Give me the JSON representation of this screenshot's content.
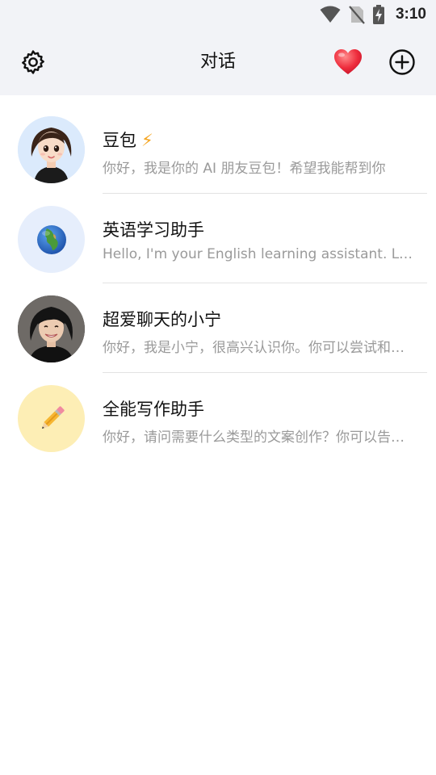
{
  "status_bar": {
    "time": "3:10",
    "icons": [
      "wifi-icon",
      "no-sim-icon",
      "battery-charging-icon"
    ]
  },
  "header": {
    "title": "对话",
    "left_icon": "gear-icon",
    "right_icons": [
      "heart-icon",
      "add-circle-icon"
    ]
  },
  "conversations": [
    {
      "name": "豆包",
      "badge": "⚡",
      "preview": "你好，我是你的 AI 朋友豆包！希望我能帮到你",
      "avatar_bg": "#dbeafc",
      "avatar_icon": "cartoon-girl-avatar"
    },
    {
      "name": "英语学习助手",
      "preview": "Hello, I'm your English learning assistant. Let's start!",
      "avatar_bg": "#e6eefc",
      "avatar_icon": "globe-icon",
      "avatar_glyph": "🌍"
    },
    {
      "name": "超爱聊天的小宁",
      "preview": "你好，我是小宁，很高兴认识你。你可以尝试和我聊天",
      "avatar_bg": "#3a3a3a",
      "avatar_icon": "portrait-avatar"
    },
    {
      "name": "全能写作助手",
      "preview": "你好，请问需要什么类型的文案创作？你可以告诉我",
      "avatar_bg": "#fdeeb5",
      "avatar_icon": "pencil-icon",
      "avatar_glyph": "✏️"
    }
  ],
  "colors": {
    "header_bg": "#f2f3f7",
    "preview_text": "#9a9a9a",
    "divider": "#e3e3e3"
  }
}
